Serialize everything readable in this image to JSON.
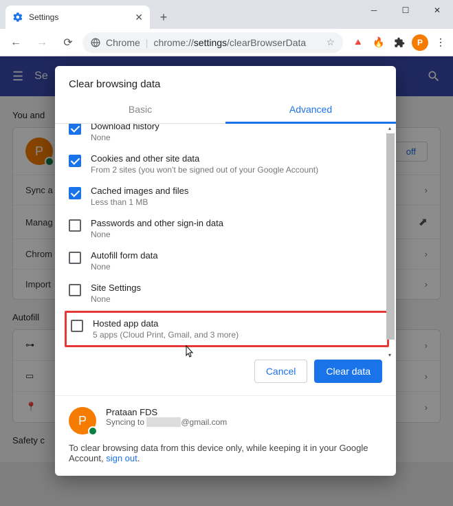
{
  "window": {
    "tab_title": "Settings",
    "url_label": "Chrome",
    "url_scheme": "chrome://",
    "url_path_bold": "settings",
    "url_path_rest": "/clearBrowserData"
  },
  "bg_settings": {
    "header_title": "Se",
    "you_section": "You and",
    "turn_off": "off",
    "avatar_initial": "P",
    "rows": {
      "sync": "Sync a",
      "manage": "Manag",
      "chrome": "Chrom",
      "import": "Import"
    },
    "autofill": "Autofill",
    "safety": "Safety c"
  },
  "dialog": {
    "title": "Clear browsing data",
    "tab_basic": "Basic",
    "tab_advanced": "Advanced",
    "options": [
      {
        "title": "Download history",
        "sub": "None",
        "checked": true
      },
      {
        "title": "Cookies and other site data",
        "sub": "From 2 sites (you won't be signed out of your Google Account)",
        "checked": true
      },
      {
        "title": "Cached images and files",
        "sub": "Less than 1 MB",
        "checked": true
      },
      {
        "title": "Passwords and other sign-in data",
        "sub": "None",
        "checked": false
      },
      {
        "title": "Autofill form data",
        "sub": "None",
        "checked": false
      },
      {
        "title": "Site Settings",
        "sub": "None",
        "checked": false
      },
      {
        "title": "Hosted app data",
        "sub": "5 apps (Cloud Print, Gmail, and 3 more)",
        "checked": false
      }
    ],
    "cancel": "Cancel",
    "clear": "Clear data",
    "account_name": "Prataan FDS",
    "account_sync_prefix": "Syncing to ",
    "account_email_suffix": "@gmail.com",
    "footer_text": "To clear browsing data from this device only, while keeping it in your Google Account, ",
    "footer_link": "sign out"
  }
}
